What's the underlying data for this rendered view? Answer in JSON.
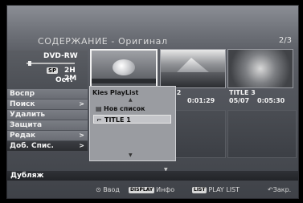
{
  "header": {
    "title": "СОДЕРЖАНИЕ - Оригинал",
    "page": "2/3"
  },
  "disc": {
    "type": "DVD-RW",
    "mode_badge": "SP",
    "time": "2H 2M",
    "remaining": "Ост."
  },
  "menu": {
    "items": [
      {
        "label": "Воспр",
        "arrow": ""
      },
      {
        "label": "Поиск",
        "arrow": ">"
      },
      {
        "label": "Удалить",
        "arrow": ""
      },
      {
        "label": "Защита",
        "arrow": ""
      },
      {
        "label": "Редак",
        "arrow": ">"
      },
      {
        "label": "Доб. Спис.",
        "arrow": ">"
      }
    ],
    "dub_label": "Дубляж"
  },
  "titles": [
    {
      "name": "",
      "date": "",
      "duration": ""
    },
    {
      "name": "TLE 2",
      "date": "",
      "duration": "0:01:29"
    },
    {
      "name": "TITLE 3",
      "date": "05/07",
      "duration": "0:05:30"
    }
  ],
  "popup": {
    "title": "Kies PlayList",
    "items": [
      {
        "label": "Нов список",
        "icon": "film-icon"
      },
      {
        "label": "TITLE 1",
        "icon": "folder-icon"
      }
    ]
  },
  "footer": {
    "enter_label": "Ввод",
    "display_key": "DISPLAY",
    "display_label": "Инфо",
    "list_key": "LIST",
    "list_label": "PLAY LIST",
    "close_label": "Закр."
  }
}
